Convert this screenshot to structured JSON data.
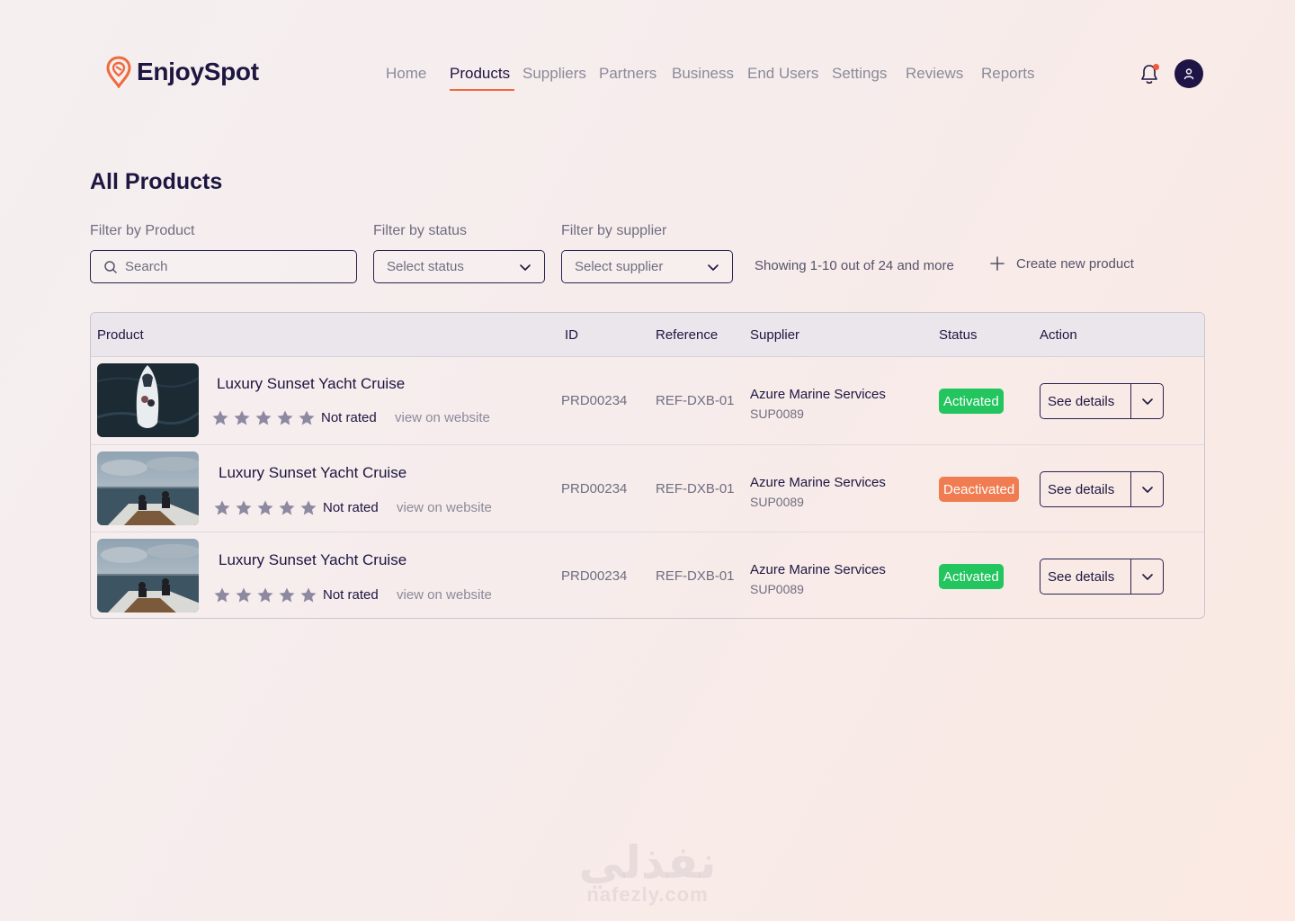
{
  "brand": {
    "name": "EnjoySpot",
    "accent": "#ef6a3d",
    "navy": "#1d1640"
  },
  "nav": {
    "items": [
      "Home",
      "Products",
      "Suppliers",
      "Partners",
      "Business",
      "End Users",
      "Settings",
      "Reviews",
      "Reports"
    ],
    "active": "Products"
  },
  "header_icons": {
    "notifications": "bell-icon",
    "profile": "user-avatar-icon"
  },
  "page": {
    "title": "All Products"
  },
  "filters": {
    "product": {
      "label": "Filter by Product",
      "placeholder": "Search"
    },
    "status": {
      "label": "Filter by status",
      "value": "Select status"
    },
    "supplier": {
      "label": "Filter by supplier",
      "value": "Select supplier"
    },
    "showing": "Showing 1-10 out of 24 and more",
    "create": "Create new product"
  },
  "table": {
    "headers": {
      "product": "Product",
      "id": "ID",
      "reference": "Reference",
      "supplier": "Supplier",
      "status": "Status",
      "action": "Action"
    },
    "rows": [
      {
        "name": "Luxury Sunset Yacht Cruise",
        "rating_text": "Not rated",
        "link": "view on website",
        "id": "PRD00234",
        "reference": "REF-DXB-01",
        "supplier": "Azure Marine Services",
        "supplier_id": "SUP0089",
        "status": "Activated",
        "action": "See details"
      },
      {
        "name": "Luxury Sunset Yacht Cruise",
        "rating_text": "Not rated",
        "link": "view on website",
        "id": "PRD00234",
        "reference": "REF-DXB-01",
        "supplier": "Azure Marine Services",
        "supplier_id": "SUP0089",
        "status": "Deactivated",
        "action": "See details"
      },
      {
        "name": "Luxury Sunset Yacht Cruise",
        "rating_text": "Not rated",
        "link": "view on website",
        "id": "PRD00234",
        "reference": "REF-DXB-01",
        "supplier": "Azure Marine Services",
        "supplier_id": "SUP0089",
        "status": "Activated",
        "action": "See details"
      }
    ]
  },
  "status_colors": {
    "Activated": "#22c55e",
    "Deactivated": "#f07d52"
  },
  "watermark": {
    "arabic": "نفذلي",
    "latin": "nafezly.com"
  }
}
